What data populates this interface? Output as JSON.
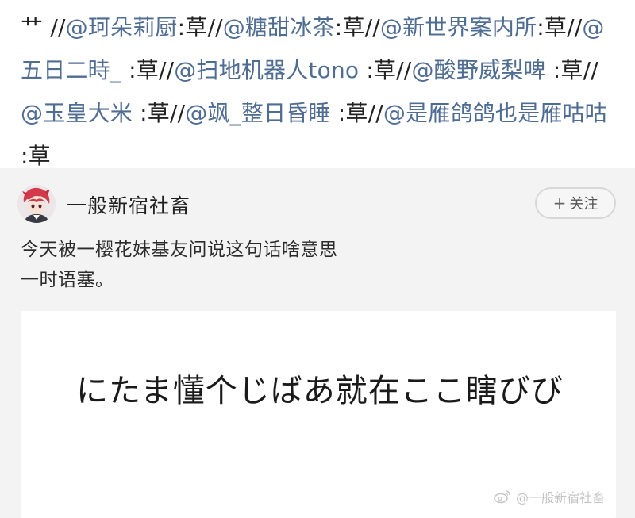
{
  "repost_chain": {
    "leading_glyph": "艹",
    "separator": "//",
    "colon": ":",
    "entries": [
      {
        "mention": "@珂朵莉厨",
        "reply": "草"
      },
      {
        "mention": "@糖甜冰茶",
        "reply": "草"
      },
      {
        "mention": "@新世界案内所",
        "reply": "草"
      },
      {
        "mention": "@五日二時_ ",
        "reply": "草"
      },
      {
        "mention": "@扫地机器人tono ",
        "reply": "草"
      },
      {
        "mention": "@酸野威梨啤 ",
        "reply": "草"
      },
      {
        "mention": "@玉皇大米 ",
        "reply": "草"
      },
      {
        "mention": "@飒_整日昏睡 ",
        "reply": "草"
      },
      {
        "mention": "@是雁鸽鸽也是雁咕咕 ",
        "reply": "草"
      }
    ]
  },
  "post": {
    "author": "一般新宿社畜",
    "follow_label": "关注",
    "follow_plus": "+",
    "body_lines": [
      "今天被一樱花妹基友问说这句话啥意思",
      "一时语塞。"
    ],
    "image_text": "にたま懂个じばあ就在ここ瞎びび",
    "watermark": "@一般新宿社畜"
  },
  "colors": {
    "mention": "#4f6c93",
    "card_background": "#f3f3f3",
    "page_background": "#ffffff"
  }
}
